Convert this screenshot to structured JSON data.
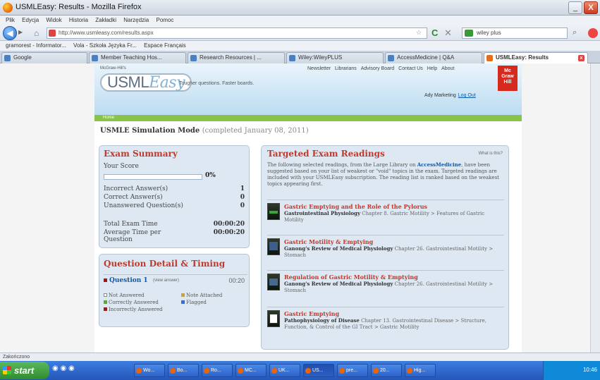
{
  "window": {
    "title": "USMLEasy: Results - Mozilla Firefox",
    "minimize": "_",
    "close": "X"
  },
  "menu": [
    "Plik",
    "Edycja",
    "Widok",
    "Historia",
    "Zakładki",
    "Narzędzia",
    "Pomoc"
  ],
  "navbar": {
    "back": "◀",
    "forward": "▶",
    "url": "http://www.usmleasy.com/results.aspx",
    "search_value": "wiley plus"
  },
  "bookmarks": [
    "gramorest - Informator...",
    "Vola - Szkoła Języka Fr...",
    "Espace Français"
  ],
  "tabs": [
    {
      "label": "Google"
    },
    {
      "label": "Member Teaching Hos..."
    },
    {
      "label": "Research Resources | ..."
    },
    {
      "label": "Wiley:WileyPLUS"
    },
    {
      "label": "AccessMedicine | Q&A"
    },
    {
      "label": "USMLEasy: Results"
    }
  ],
  "site": {
    "logo_small": "McGraw-Hill's",
    "logo_usml": "USML",
    "logo_easy": "Easy",
    "tagline": "Tougher questions. Faster boards.",
    "top_links": [
      "Newsletter",
      "Librarians",
      "Advisory Board",
      "Contact Us",
      "Help",
      "About"
    ],
    "mh_logo": "Mc Graw Hill",
    "user": "Ady Marketing",
    "logout": "Log Out",
    "home_link": "Home",
    "sim_title": "USMLE Simulation Mode",
    "sim_sub": "(completed January 08, 2011)"
  },
  "exam_summary": {
    "title": "Exam Summary",
    "score_label": "Your Score",
    "score_pct": "0%",
    "score_fraction": 0.0,
    "rows": [
      {
        "label": "Incorrect Answer(s)",
        "value": "1"
      },
      {
        "label": "Correct Answer(s)",
        "value": "0"
      },
      {
        "label": "Unanswered Question(s)",
        "value": "0"
      },
      {
        "label": "Total Exam Time",
        "value": "00:00:20"
      },
      {
        "label": "Average Time per Question",
        "value": "00:00:20"
      }
    ]
  },
  "question_detail": {
    "title": "Question Detail & Timing",
    "question": "Question 1",
    "note": "(view answer)",
    "time": "00:20",
    "legend": [
      {
        "label": "Not Answered",
        "color": "#ffffff"
      },
      {
        "label": "Note Attached",
        "color": "#c8a04a"
      },
      {
        "label": "Correctly Answered",
        "color": "#5aa63a"
      },
      {
        "label": "Flagged",
        "color": "#3a6ec8"
      },
      {
        "label": "Incorrectly Answered",
        "color": "#a11a1a"
      }
    ]
  },
  "readings": {
    "title": "Targeted Exam Readings",
    "whats": "What is this?",
    "intro_pre": "The following selected readings, from the Large Library on",
    "intro_bold": "AccessMedicine",
    "intro_post": ", have been suggested based on your list of weakest or \"void\" topics in the exam. Targeted readings are included with your USMLEasy subscription. The reading list is ranked based on the weakest topics appearing first.",
    "items": [
      {
        "title": "Gastric Emptying and the Role of the Pylorus",
        "book": "Gastrointestinal Physiology",
        "detail": "Chapter 8. Gastric Motility > Features of Gastric Motility"
      },
      {
        "title": "Gastric Motility & Emptying",
        "book": "Ganong's Review of Medical Physiology",
        "detail": "Chapter 26. Gastrointestinal Motility > Stomach"
      },
      {
        "title": "Regulation of Gastric Motility & Emptying",
        "book": "Ganong's Review of Medical Physiology",
        "detail": "Chapter 26. Gastrointestinal Motility > Stomach"
      },
      {
        "title": "Gastric Emptying",
        "book": "Pathophysiology of Disease",
        "detail": "Chapter 13. Gastrointestinal Disease > Structure, Function, & Control of the GI Tract > Gastric Motility"
      }
    ]
  },
  "status": "Zakończono",
  "taskbar": {
    "start": "start",
    "tasks": [
      "Wo...",
      "Bo...",
      "Ro...",
      "MC...",
      "UK...",
      "US...",
      "pre...",
      "20...",
      "Hig..."
    ],
    "clock": "10:46"
  }
}
